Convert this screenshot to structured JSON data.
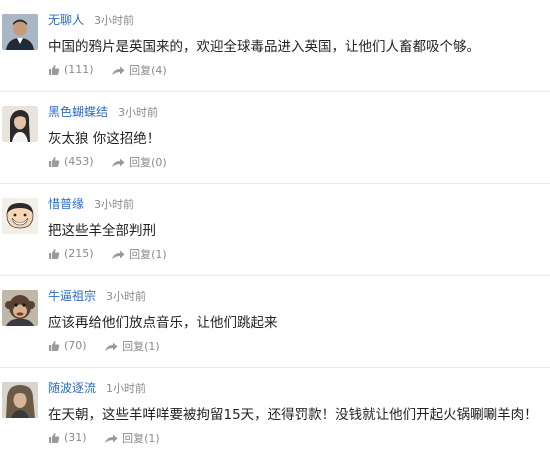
{
  "comments": [
    {
      "user": "无聊人",
      "time": "3小时前",
      "text": "中国的鸦片是英国来的，欢迎全球毒品进入英国，让他们人畜都吸个够。",
      "likes": "(111)",
      "reply_label": "回复",
      "replies": "(4)",
      "avatar_icon": "man-portrait-avatar"
    },
    {
      "user": "黑色蝴蝶结",
      "time": "3小时前",
      "text": "灰太狼 你这招绝！",
      "likes": "(453)",
      "reply_label": "回复",
      "replies": "(0)",
      "avatar_icon": "woman-portrait-avatar"
    },
    {
      "user": "惜普缘",
      "time": "3小时前",
      "text": "把这些羊全部判刑",
      "likes": "(215)",
      "reply_label": "回复",
      "replies": "(1)",
      "avatar_icon": "cartoon-boy-avatar"
    },
    {
      "user": "牛逼祖宗",
      "time": "3小时前",
      "text": "应该再给他们放点音乐，让他们跳起来",
      "likes": "(70)",
      "reply_label": "回复",
      "replies": "(1)",
      "avatar_icon": "monkey-avatar"
    },
    {
      "user": "随波逐流",
      "time": "1小时前",
      "text": "在天朝，这些羊咩咩要被拘留15天，还得罚款！没钱就让他们开起火锅唰唰羊肉！",
      "likes": "(31)",
      "reply_label": "回复",
      "replies": "(1)",
      "avatar_icon": "long-hair-avatar"
    }
  ],
  "colors": {
    "username": "#2b6cc4",
    "meta": "#8a8a8a",
    "text": "#222222",
    "divider": "#e9e9e9"
  }
}
